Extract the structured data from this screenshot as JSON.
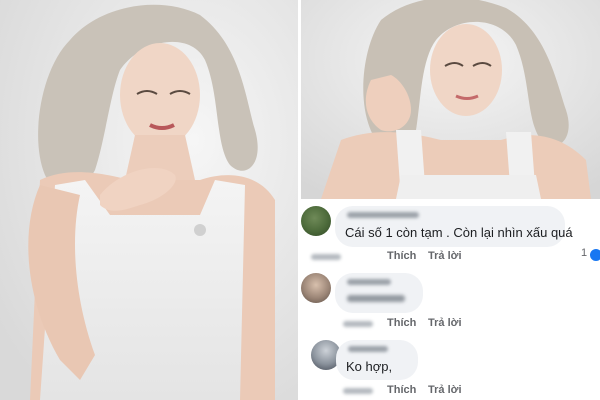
{
  "comments": [
    {
      "text": "Cái số 1 còn tạm . Còn lại nhìn xấu quá",
      "like_label": "Thích",
      "reply_label": "Trả lời",
      "reaction_count": "1"
    },
    {
      "text": "",
      "like_label": "Thích",
      "reply_label": "Trả lời"
    },
    {
      "text": "Ko hợp,",
      "like_label": "Thích",
      "reply_label": "Trả lời"
    }
  ],
  "colors": {
    "bubble": "#f0f2f5",
    "meta_text": "#65676b",
    "comment_text": "#1c1e21",
    "reaction": "#1877f2"
  },
  "icons": [
    "like-reaction-icon"
  ]
}
